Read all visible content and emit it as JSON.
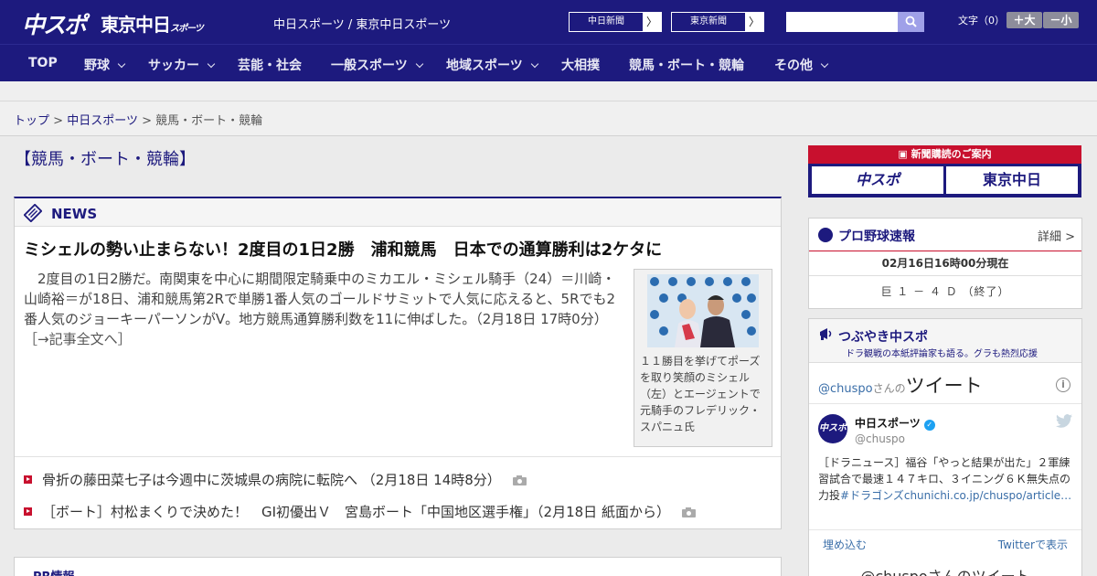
{
  "header": {
    "logo_chuspo": "中スポ",
    "logo_tokyo": "東京中日",
    "logo_tokyo_sub": "スポーツ",
    "site_names": "中日スポーツ / 東京中日スポーツ",
    "link_chunichi": "中日新聞",
    "link_tokyo": "東京新聞",
    "arrow": "〉",
    "search_placeholder": "",
    "fontsize_label": "文字（0）",
    "fontsize_up": "＋大",
    "fontsize_down": "－小"
  },
  "nav": {
    "items": [
      {
        "label": "TOP"
      },
      {
        "label": "野球"
      },
      {
        "label": "サッカー"
      },
      {
        "label": "芸能・社会"
      },
      {
        "label": "一般スポーツ"
      },
      {
        "label": "地域スポーツ"
      },
      {
        "label": "大相撲"
      },
      {
        "label": "競馬・ボート・競輪"
      },
      {
        "label": "その他"
      }
    ]
  },
  "breadcrumb": {
    "top": "トップ",
    "sep": ">",
    "chunichi": "中日スポーツ",
    "current": "競馬・ボート・競輪"
  },
  "page_title": "【競馬・ボート・競輪】",
  "news": {
    "section_label": "NEWS",
    "headline": "ミシェルの勢い止まらない！2度目の1日2勝　浦和競馬　日本での通算勝利は2ケタに",
    "lead": "2度目の1日2勝だ。南関東を中心に期間限定騎乗中のミカエル・ミシェル騎手（24）＝川崎・山崎裕＝が18日、浦和競馬第2Rで単勝1番人気のゴールドサミットで人気に応えると、5Rでも2番人気のジョーキーパーソンがV。地方競馬通算勝利数を11に伸ばした。（2月18日 17時0分）",
    "more_link": "［→記事全文へ］",
    "photo_caption": "１１勝目を挙げてポーズを取り笑顔のミシェル（左）とエージェントで元騎手のフレデリック・スパニュ氏",
    "items": [
      {
        "text": "骨折の藤田菜七子は今週中に茨城県の病院に転院へ （2月18日 14時8分）"
      },
      {
        "text": "［ボート］村松まくりで決めた！　GI初優出Ｖ　宮島ボート「中国地区選手権」（2月18日 紙面から）"
      }
    ]
  },
  "pr": {
    "label": "PR情報"
  },
  "subscribe": {
    "title": "新聞購読のご案内",
    "logo_chuspo": "中スポ",
    "logo_tokyo": "東京中日"
  },
  "baseball": {
    "title": "プロ野球速報",
    "detail_link": "詳細 >",
    "time": "02月16日16時00分現在",
    "score": "巨 １ － ４ Ｄ （終了）"
  },
  "tweets": {
    "title": "つぶやき中スポ",
    "subtitle": "ドラ観戦の本紙評論家も語る。グラも熱烈応援",
    "handle_prefix": "@chuspo",
    "san": "さんの",
    "tweet_word": "ツイート",
    "avatar_text": "中スポ",
    "account_name": "中日スポーツ",
    "account_handle": "@chuspo",
    "text": "［ドラニュース］福谷「やっと結果が出た」２軍練習試合で最速１４７キロ、３イニング６Ｋ無失点の力投",
    "hashtag": "#ドラゴンズ",
    "link": "chunichi.co.jp/chuspo/article…",
    "embed": "埋め込む",
    "view_on_twitter": "Twitterで表示",
    "bottom_title": "@chuspoさんのツイート"
  }
}
